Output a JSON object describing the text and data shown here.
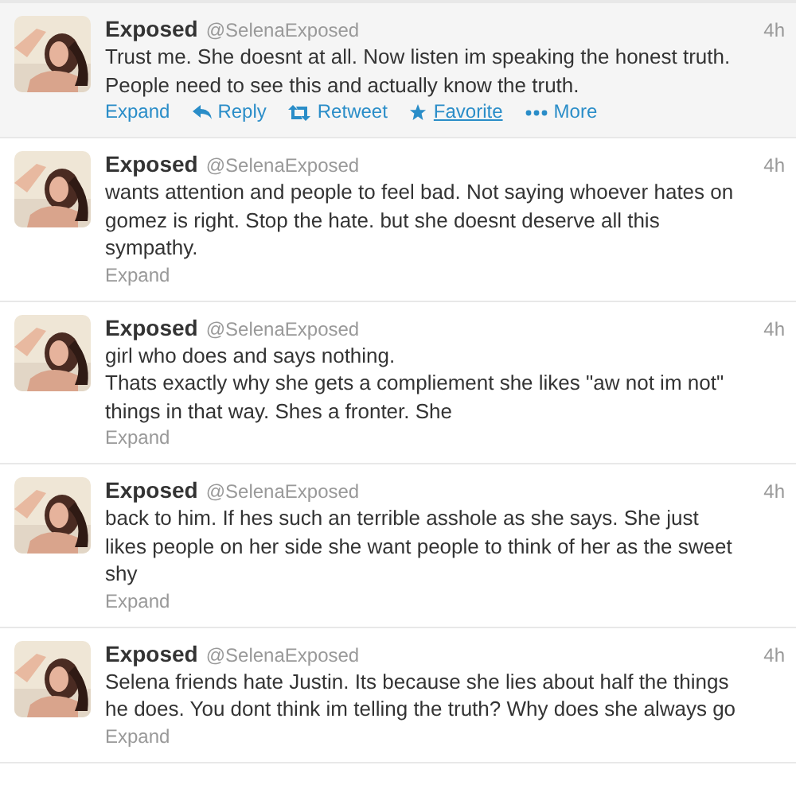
{
  "tweets": [
    {
      "name": "Exposed",
      "handle": "@SelenaExposed",
      "time": "4h",
      "hovered": true,
      "lines": [
        "Trust me. She doesnt at all. Now listen im speaking the honest truth.",
        "People need to see this and actually know the truth."
      ],
      "expand": "Expand",
      "actions": [
        {
          "kind": "reply",
          "label": "Reply",
          "underlined": false
        },
        {
          "kind": "retweet",
          "label": "Retweet",
          "underlined": false
        },
        {
          "kind": "favorite",
          "label": "Favorite",
          "underlined": true
        },
        {
          "kind": "more",
          "label": "More",
          "underlined": false
        }
      ]
    },
    {
      "name": "Exposed",
      "handle": "@SelenaExposed",
      "time": "4h",
      "hovered": false,
      "lines": [
        "wants attention and people to feel bad. Not saying whoever hates on",
        "gomez is right. Stop the hate. but she doesnt deserve all this",
        "sympathy."
      ],
      "expand": "Expand"
    },
    {
      "name": "Exposed",
      "handle": "@SelenaExposed",
      "time": "4h",
      "hovered": false,
      "lines": [
        "girl who does and says nothing.",
        "Thats exactly why she gets a compliement she likes \"aw not im not\"",
        "things in that way. Shes a fronter.  She"
      ],
      "expand": "Expand"
    },
    {
      "name": "Exposed",
      "handle": "@SelenaExposed",
      "time": "4h",
      "hovered": false,
      "lines": [
        "back to him. If hes such an terrible asshole as she says. She just",
        "likes people on her side she want people to think of her as the sweet",
        "shy"
      ],
      "expand": "Expand"
    },
    {
      "name": "Exposed",
      "handle": "@SelenaExposed",
      "time": "4h",
      "hovered": false,
      "lines": [
        "Selena friends hate Justin. Its because she lies about half the things",
        "he does. You dont think im telling the truth? Why does she always go"
      ],
      "expand": "Expand"
    }
  ]
}
